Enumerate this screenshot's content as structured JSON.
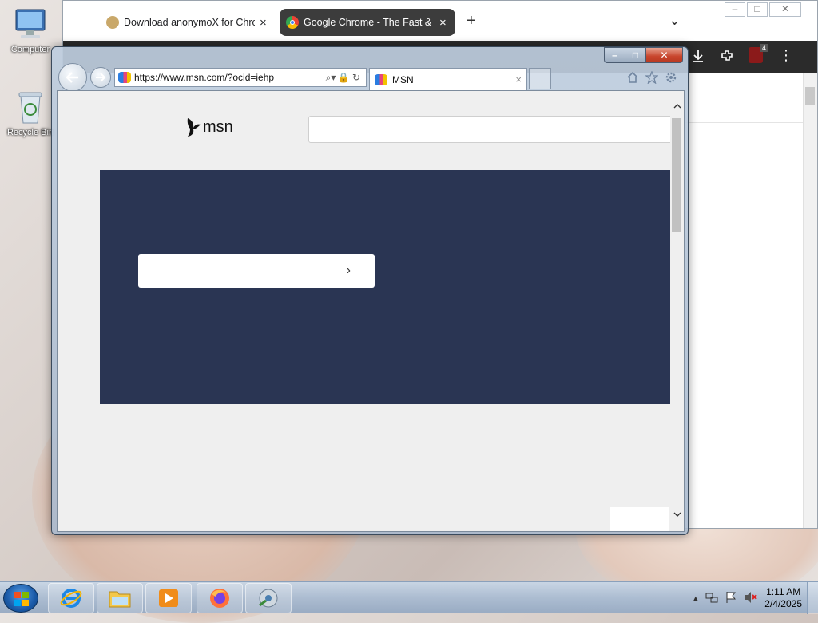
{
  "desktop": {
    "icons": [
      {
        "label": "Computer",
        "icon": "computer-icon"
      },
      {
        "label": "Recycle Bin",
        "icon": "recycle-bin-icon"
      }
    ]
  },
  "chrome": {
    "tabs": [
      {
        "label": "Download anonymoX for Chrome",
        "close": "×",
        "active": false
      },
      {
        "label": "Google Chrome - The Fast & Secure",
        "close": "×",
        "active": true
      }
    ],
    "new_tab": "+",
    "tab_search": "⌄",
    "window_controls": [
      "–",
      "□",
      "✕"
    ],
    "extension_badge": "4",
    "menu": "⋮"
  },
  "ie": {
    "address_url": "https://www.msn.com/?ocid=iehp",
    "tab_label": "MSN",
    "tab_close": "×",
    "caption": {
      "min": "–",
      "max": "□",
      "close": "✕"
    },
    "tools": [
      "home-icon",
      "favorites-star-icon",
      "settings-gear-icon"
    ]
  },
  "msn": {
    "logo_text": "msn",
    "search_placeholder": "",
    "cta_arrow": "›",
    "panel_color": "#2a3553"
  },
  "taskbar": {
    "apps": [
      "internet-explorer-icon",
      "file-explorer-icon",
      "media-player-icon",
      "firefox-icon",
      "media-center-icon"
    ],
    "time": "1:11 AM",
    "date": "2/4/2025",
    "tray_show_hidden": "▲"
  }
}
